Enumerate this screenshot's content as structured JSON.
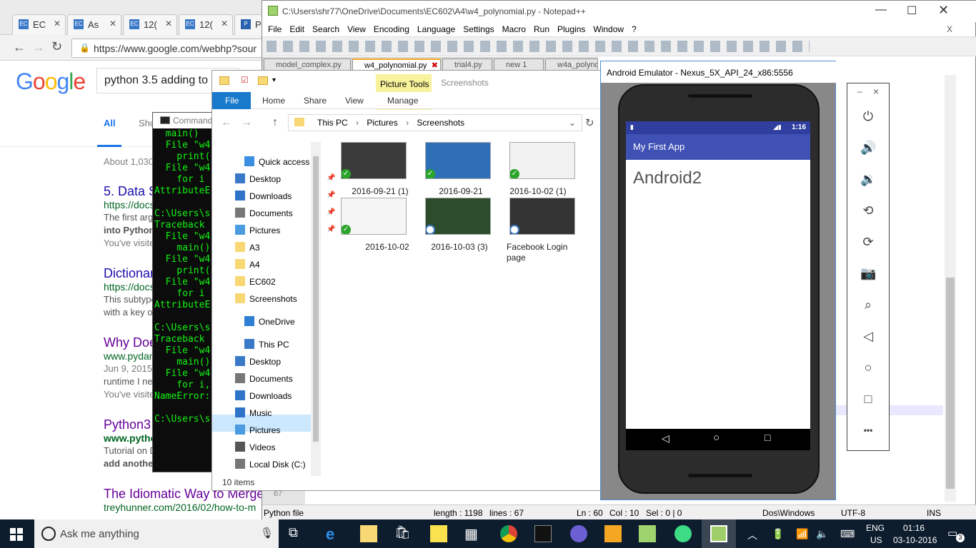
{
  "chrome": {
    "tabs": [
      {
        "label": "EC"
      },
      {
        "label": "As"
      },
      {
        "label": "12("
      },
      {
        "label": "12("
      },
      {
        "label": "P"
      }
    ],
    "url": "https://www.google.com/webhp?sour",
    "search_query": "python 3.5 adding to",
    "logo": "Google",
    "search_tabs": [
      "All",
      "Sho"
    ],
    "result_count": "About 1,030",
    "results": [
      {
        "title": "5. Data S",
        "url": "https://docs",
        "snippet": [
          "The first arg",
          "into Python",
          "You've visite"
        ]
      },
      {
        "title": "Dictionar",
        "url": "https://docs",
        "snippet": [
          "This subtype",
          "with a key o"
        ]
      },
      {
        "title": "Why Doe",
        "url": "www.pydan",
        "snippet": [
          "Jun 9, 2015",
          "runtime I ne",
          "You've visite"
        ]
      },
      {
        "title": "Python3",
        "url": "www.pytho",
        "snippet": [
          "Tutorial on D",
          "add another"
        ]
      },
      {
        "title": "The Idiomatic Way to Merge",
        "url": "treyhunner.com/2016/02/how-to-m",
        "snippet": []
      }
    ]
  },
  "cmd": {
    "title": "Command",
    "lines": [
      "  main()",
      "  File \"w4",
      "    print(",
      "  File \"w4",
      "    for i",
      "AttributeE",
      "",
      "C:\\Users\\s",
      "Traceback",
      "  File \"w4",
      "    main()",
      "  File \"w4",
      "    print(",
      "  File \"w4",
      "    for i",
      "AttributeE",
      "",
      "C:\\Users\\s",
      "Traceback",
      "  File \"w4",
      "    main()",
      "  File \"w4",
      "    for i,",
      "NameError:",
      "",
      "C:\\Users\\s"
    ]
  },
  "npp": {
    "title": "C:\\Users\\shr77\\OneDrive\\Documents\\EC602\\A4\\w4_polynomial.py - Notepad++",
    "menu": [
      "File",
      "Edit",
      "Search",
      "View",
      "Encoding",
      "Language",
      "Settings",
      "Macro",
      "Run",
      "Plugins",
      "Window",
      "?"
    ],
    "close_x": "X",
    "tabs": [
      "model_complex.py",
      "w4_polynomial.py",
      "trial4.py",
      "new 1",
      "w4a_polyno"
    ],
    "line_no": "67",
    "status": {
      "type": "Python file",
      "length": "length : 1198",
      "lines": "lines : 67",
      "ln": "Ln : 60",
      "col": "Col : 10",
      "sel": "Sel : 0 | 0",
      "eol": "Dos\\Windows",
      "enc": "UTF-8",
      "ins": "INS"
    }
  },
  "explorer": {
    "ribbon": {
      "file": "File",
      "home": "Home",
      "share": "Share",
      "view": "View",
      "pictools": "Picture Tools",
      "manage": "Manage",
      "screenshots": "Screenshots"
    },
    "breadcrumb": [
      "This PC",
      "Pictures",
      "Screenshots"
    ],
    "nav": [
      {
        "label": "Quick access"
      },
      {
        "label": "Desktop"
      },
      {
        "label": "Downloads"
      },
      {
        "label": "Documents"
      },
      {
        "label": "Pictures"
      },
      {
        "label": "A3"
      },
      {
        "label": "A4"
      },
      {
        "label": "EC602"
      },
      {
        "label": "Screenshots"
      },
      {
        "label": "OneDrive"
      },
      {
        "label": "This PC"
      },
      {
        "label": "Desktop"
      },
      {
        "label": "Documents"
      },
      {
        "label": "Downloads"
      },
      {
        "label": "Music"
      },
      {
        "label": "Pictures"
      },
      {
        "label": "Videos"
      },
      {
        "label": "Local Disk (C:)"
      }
    ],
    "files": [
      {
        "name": "2016-09-21 (1)"
      },
      {
        "name": "2016-09-21"
      },
      {
        "name": "2016-10-02 (1)"
      },
      {
        "name": "2016-10-02"
      },
      {
        "name": "2016-10-03 (3)"
      },
      {
        "name": "Facebook Login page"
      }
    ],
    "item_count": "10 items"
  },
  "emulator": {
    "title": "Android Emulator - Nexus_5X_API_24_x86:5556",
    "time": "1:16",
    "app_title": "My First App",
    "content": "Android2",
    "panel_min": "–",
    "panel_close": "×",
    "panel_more": "•••"
  },
  "taskbar": {
    "search_placeholder": "Ask me anything",
    "lang": "ENG",
    "region": "US",
    "time": "01:16",
    "date": "03-10-2016",
    "notif": "3"
  }
}
